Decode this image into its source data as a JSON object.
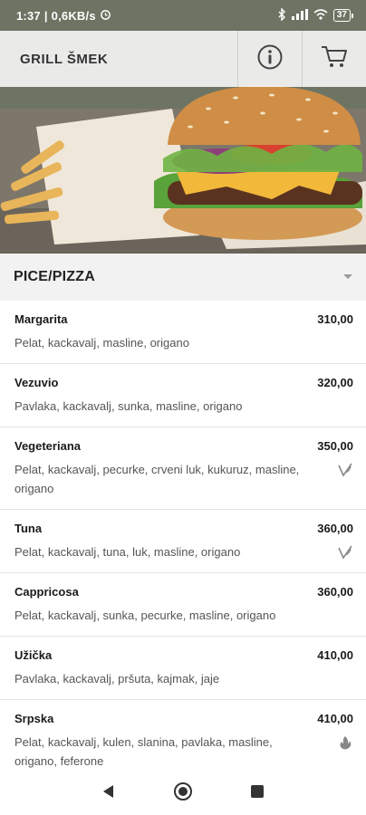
{
  "status_bar": {
    "time": "1:37",
    "speed": "0,6KB/s",
    "battery": "37",
    "icons": [
      "alarm-icon",
      "bluetooth-icon",
      "signal-icon",
      "wifi-icon",
      "battery-icon"
    ]
  },
  "app_bar": {
    "title": "GRILL ŠMEK",
    "info_icon": "info-icon",
    "cart_icon": "cart-icon"
  },
  "category": {
    "title": "PICE/PIZZA",
    "icon": "dropdown-arrow-icon"
  },
  "menu": {
    "items": [
      {
        "name": "Margarita",
        "price": "310,00",
        "description": "Pelat, kackavalj, masline, origano",
        "tag": ""
      },
      {
        "name": "Vezuvio",
        "price": "320,00",
        "description": "Pavlaka, kackavalj, sunka, masline, origano",
        "tag": ""
      },
      {
        "name": "Vegeteriana",
        "price": "350,00",
        "description": "Pelat, kackavalj, pecurke, crveni luk, kukuruz, masline, origano",
        "tag": "vegetarian-icon"
      },
      {
        "name": "Tuna",
        "price": "360,00",
        "description": "Pelat, kackavalj, tuna, luk, masline, origano",
        "tag": "vegetarian-icon"
      },
      {
        "name": "Cappricosa",
        "price": "360,00",
        "description": "Pelat, kackavalj, sunka, pecurke, masline, origano",
        "tag": ""
      },
      {
        "name": "Užička",
        "price": "410,00",
        "description": "Pavlaka, kackavalj, pršuta, kajmak, jaje",
        "tag": ""
      },
      {
        "name": "Srpska",
        "price": "410,00",
        "description": "Pelat, kackavalj, kulen, slanina, pavlaka, masline, origano, feferone",
        "tag": "spicy-icon"
      }
    ]
  },
  "nav_bar": {
    "icons": [
      "back-icon",
      "home-icon",
      "recents-icon"
    ]
  },
  "colors": {
    "category_bg": "#f2f2f2",
    "divider": "#e4e4e4",
    "tag_icon": "#888888"
  }
}
